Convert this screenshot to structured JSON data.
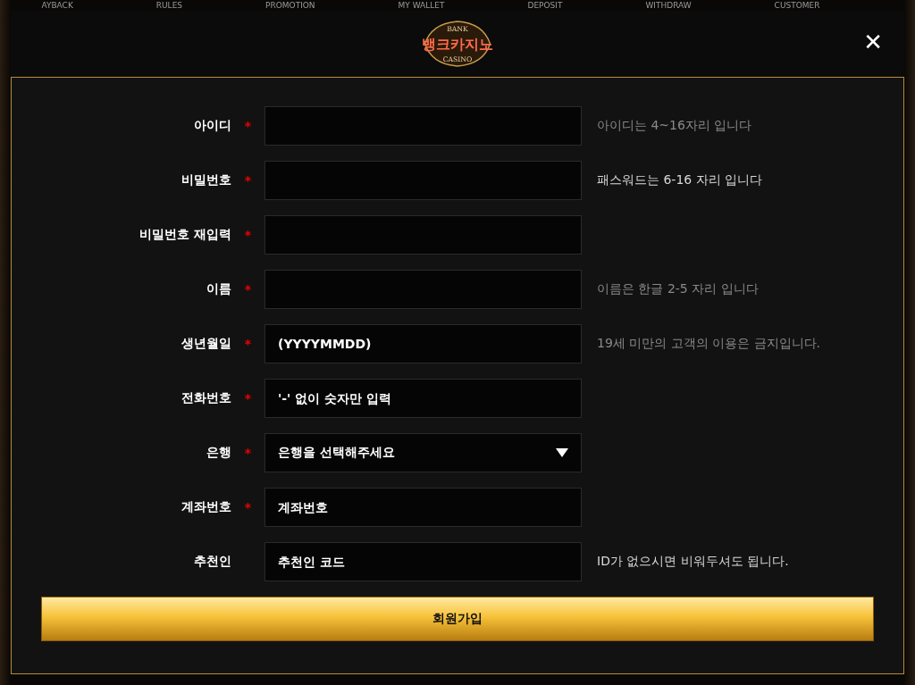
{
  "background_nav": [
    "AYBACK",
    "RULES",
    "PROMOTION",
    "MY WALLET",
    "DEPOSIT",
    "WITHDRAW",
    "CUSTOMER"
  ],
  "logo": {
    "top": "BANK",
    "name": "뱅크카지노",
    "bottom": "CASINO"
  },
  "close": "✕",
  "required_mark": "*",
  "fields": [
    {
      "label": "아이디",
      "required": true,
      "kind": "text",
      "hint": "아이디는 4~16자리 입니다",
      "hint_bright": false
    },
    {
      "label": "비밀번호",
      "required": true,
      "kind": "text",
      "hint": "패스워드는 6-16 자리 입니다",
      "hint_bright": true
    },
    {
      "label": "비밀번호 재입력",
      "required": true,
      "kind": "text"
    },
    {
      "label": "이름",
      "required": true,
      "kind": "text",
      "hint": "이름은 한글 2-5 자리 입니다",
      "hint_bright": false
    },
    {
      "label": "생년월일",
      "required": true,
      "kind": "text",
      "placeholder": "(YYYYMMDD)",
      "hint": "19세 미만의 고객의 이용은 금지입니다.",
      "hint_bright": false
    },
    {
      "label": "전화번호",
      "required": true,
      "kind": "text",
      "placeholder": "'-' 없이 숫자만 입력"
    },
    {
      "label": "은행",
      "required": true,
      "kind": "select",
      "value": "은행을 선택해주세요"
    },
    {
      "label": "계좌번호",
      "required": true,
      "kind": "text",
      "placeholder": "계좌번호"
    },
    {
      "label": "추천인",
      "required": false,
      "kind": "text",
      "placeholder": "추천인 코드",
      "hint": "ID가 없으시면 비워두셔도 됩니다.",
      "hint_bright": true
    }
  ],
  "submit": "회원가입"
}
